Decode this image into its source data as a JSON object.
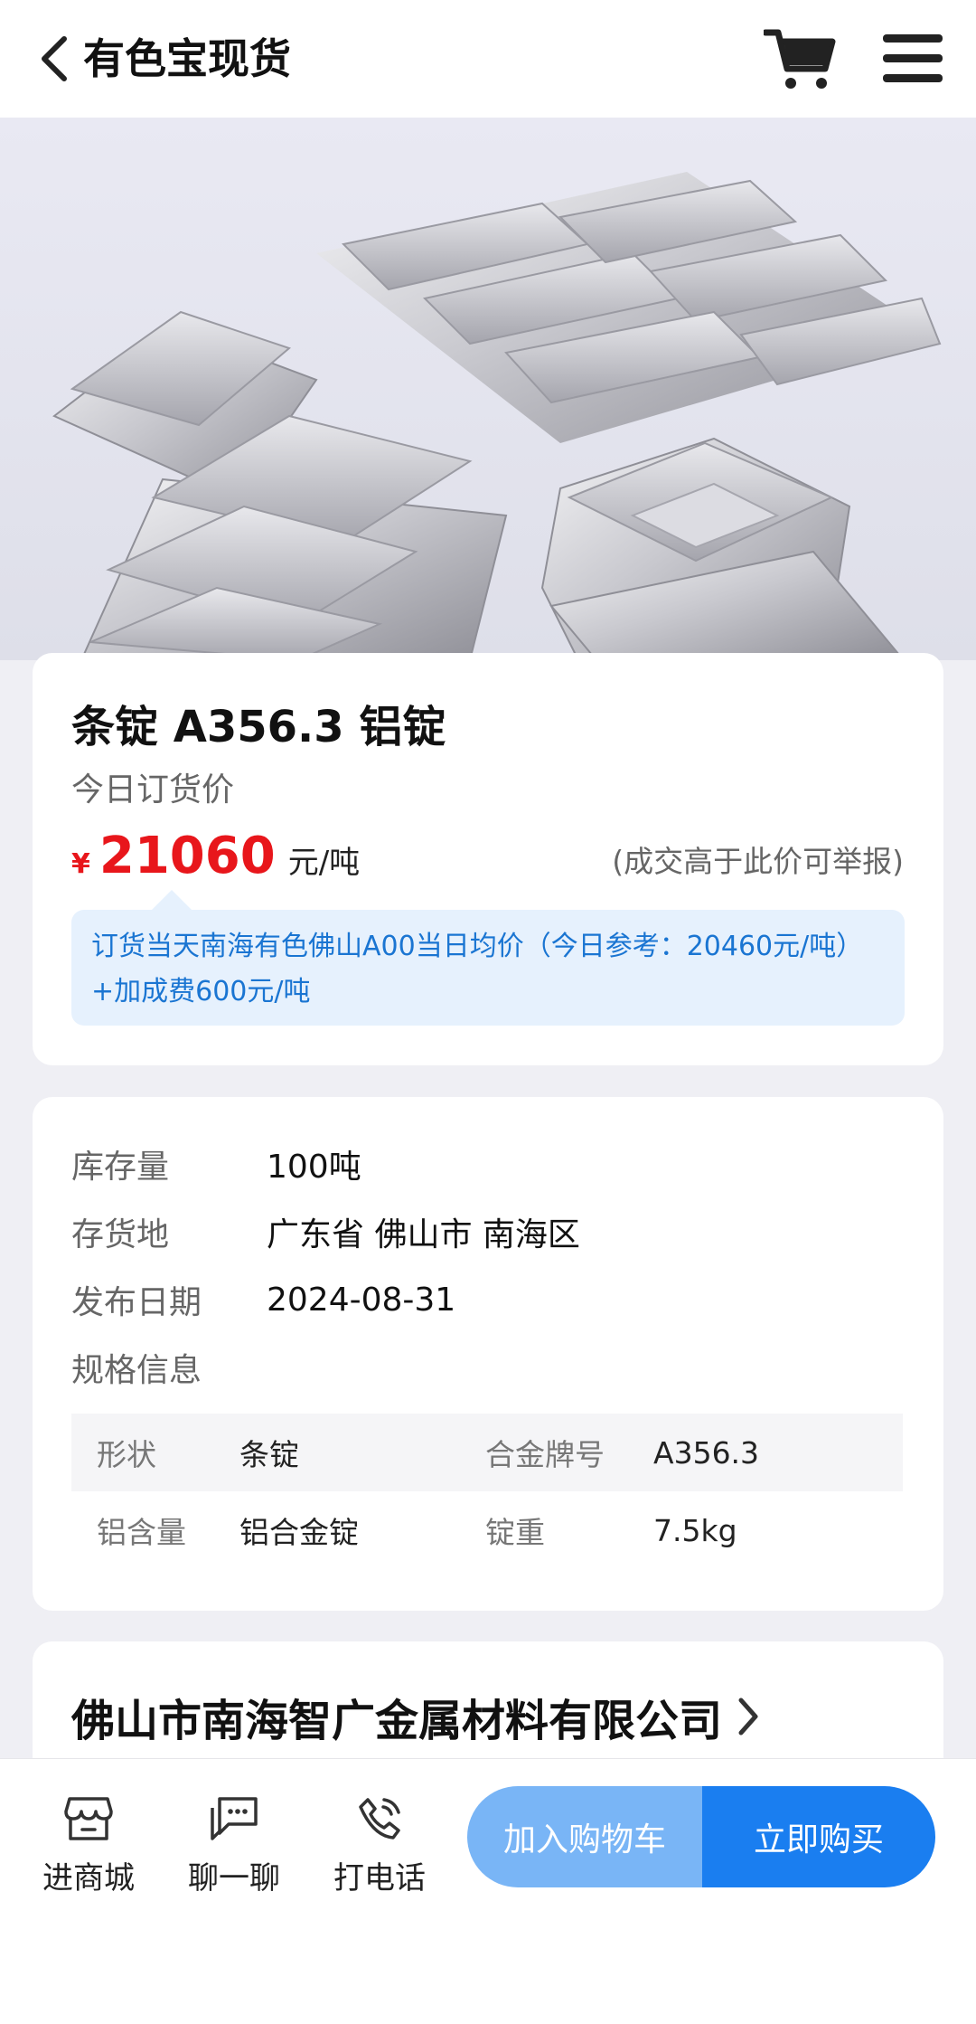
{
  "header": {
    "title": "有色宝现货",
    "back_icon": "chevron-left-icon",
    "cart_icon": "shopping-cart-icon",
    "menu_icon": "hamburger-menu-icon"
  },
  "hero": {
    "image_subject": "aluminum-ingots"
  },
  "product": {
    "title": "条锭 A356.3 铝锭",
    "price_label": "今日订货价",
    "currency_symbol": "¥",
    "price": "21060",
    "unit": "元/吨",
    "price_note": "(成交高于此价可举报)",
    "pricing_formula": "订货当天南海有色佛山A00当日均价（今日参考：20460元/吨）+加成费600元/吨"
  },
  "info": {
    "rows": [
      {
        "label": "库存量",
        "value": "100吨"
      },
      {
        "label": "存货地",
        "value": "广东省 佛山市 南海区"
      },
      {
        "label": "发布日期",
        "value": "2024-08-31"
      },
      {
        "label": "规格信息",
        "value": ""
      }
    ],
    "specs": [
      {
        "k1": "形状",
        "v1": "条锭",
        "k2": "合金牌号",
        "v2": "A356.3"
      },
      {
        "k1": "铝含量",
        "v1": "铝合金锭",
        "k2": "锭重",
        "v2": "7.5kg"
      }
    ]
  },
  "company": {
    "name": "佛山市南海智广金属材料有限公司"
  },
  "bottom_bar": {
    "store_label": "进商城",
    "chat_label": "聊一聊",
    "call_label": "打电话",
    "add_cart_label": "加入购物车",
    "buy_now_label": "立即购买"
  },
  "colors": {
    "price_red": "#e8161b",
    "accent_blue": "#1a7ef0",
    "light_blue": "#79b5f6",
    "note_bg": "#e6f1fd",
    "note_text": "#1a75d2"
  }
}
